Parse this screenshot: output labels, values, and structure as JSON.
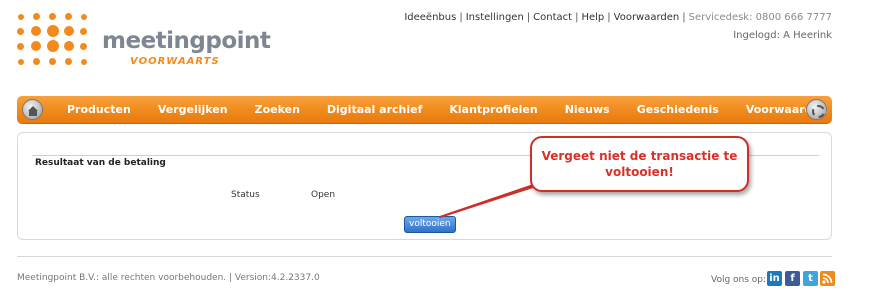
{
  "logo": {
    "name": "meetingpoint",
    "tagline": "VOORWAARTS"
  },
  "top_links": {
    "items": [
      "Ideeënbus",
      "Instellingen",
      "Contact",
      "Help",
      "Voorwaarden"
    ],
    "servicedesk": "Servicedesk: 0800 666 7777",
    "login": "Ingelogd: A Heerink"
  },
  "nav": {
    "items": [
      "Producten",
      "Vergelijken",
      "Zoeken",
      "Digitaal archief",
      "Klantprofielen",
      "Nieuws",
      "Geschiedenis",
      "Voorwaarden"
    ],
    "home_icon": "home-icon",
    "settings_icon": "gear-icon"
  },
  "content": {
    "section_title": "Resultaat van de betaling",
    "status_label": "Status",
    "status_value": "Open",
    "button_label": "voltooien"
  },
  "callout": {
    "text": "Vergeet niet de transactie te voltooien!"
  },
  "footer": {
    "text": "Meetingpoint B.V.: alle rechten voorbehouden. | Version:4.2.2337.0",
    "follow": "Volg ons op:",
    "social": [
      "in",
      "f",
      "t",
      "rss"
    ]
  },
  "colors": {
    "brand_orange": "#f28a1e",
    "callout_red": "#d8302a",
    "button_blue": "#2f72c9"
  }
}
